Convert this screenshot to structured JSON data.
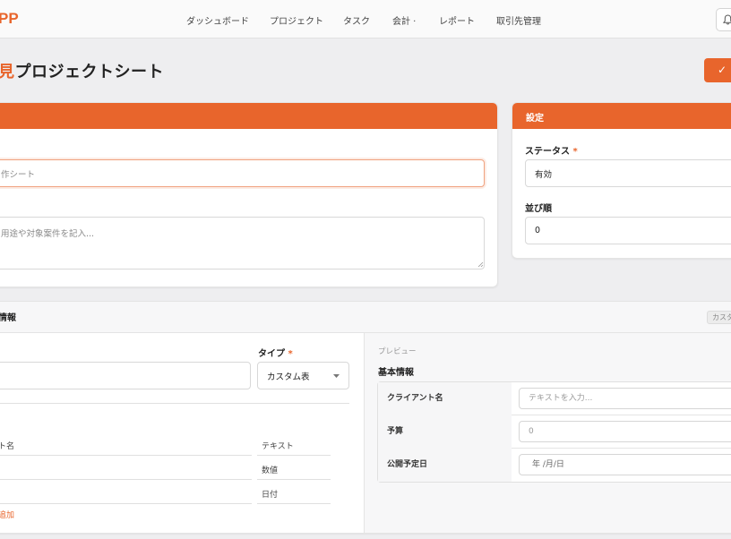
{
  "app": {
    "logo": "PP"
  },
  "nav": {
    "items": [
      "ダッシュボード",
      "プロジェクト",
      "タスク",
      "会計 ·",
      "レポート",
      "取引先管理"
    ]
  },
  "icons": {
    "bell": "bell-icon",
    "check": "check-icon",
    "chevron": "chevron-down-icon"
  },
  "page": {
    "title_accent": "見",
    "title": "プロジェクトシート",
    "save_icon": "✓"
  },
  "basic_card": {
    "name_value": "作シート",
    "description_placeholder": "用途や対象案件を記入..."
  },
  "settings": {
    "header": "設定",
    "status_label": "ステータス",
    "status_value": "有効",
    "order_label": "並び順",
    "order_value": "0"
  },
  "fields_section": {
    "header": "情報",
    "tag": "カスタ",
    "type_label": "タイプ",
    "type_value": "カスタム表",
    "item_header": "ト名",
    "types": [
      "テキスト",
      "数値",
      "日付"
    ],
    "add_link": "追加"
  },
  "preview": {
    "label": "プレビュー",
    "title": "基本情報",
    "rows": [
      {
        "label": "クライアント名",
        "value": "テキストを入力..."
      },
      {
        "label": "予算",
        "value": "0"
      },
      {
        "label": "公開予定日",
        "value": "年 /月/日"
      }
    ]
  },
  "colors": {
    "accent": "#e8652c"
  }
}
